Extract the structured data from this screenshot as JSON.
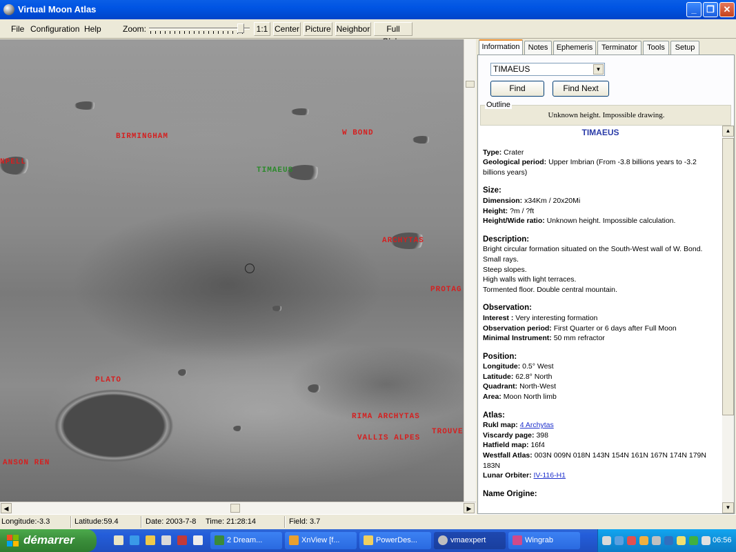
{
  "window": {
    "title": "Virtual Moon Atlas"
  },
  "menu": [
    "File",
    "Configuration",
    "Help"
  ],
  "toolbar": {
    "zoom_label": "Zoom:",
    "buttons": [
      "1:1",
      "Center",
      "Picture",
      "Neighbor",
      "Full Globe"
    ]
  },
  "map": {
    "labels": [
      {
        "text": "BIRMINGHAM",
        "color": "#d42020"
      },
      {
        "text": "W BOND",
        "color": "#d42020"
      },
      {
        "text": "NPELL",
        "color": "#d42020"
      },
      {
        "text": "TIMAEUS",
        "color": "#2a8a2a"
      },
      {
        "text": "ARCHYTAS",
        "color": "#d42020"
      },
      {
        "text": "PROTAG",
        "color": "#d42020"
      },
      {
        "text": "PLATO",
        "color": "#d42020"
      },
      {
        "text": "RIMA ARCHYTAS",
        "color": "#d42020"
      },
      {
        "text": "VALLIS ALPES",
        "color": "#d42020"
      },
      {
        "text": "TROUVE",
        "color": "#d42020"
      },
      {
        "text": "ANSON REN",
        "color": "#d42020"
      }
    ]
  },
  "tabs": [
    "Information",
    "Notes",
    "Ephemeris",
    "Terminator",
    "Tools",
    "Setup"
  ],
  "search": {
    "value": "TIMAEUS",
    "find": "Find",
    "find_next": "Find Next"
  },
  "outline": {
    "legend": "Outline",
    "message": "Unknown height. Impossible drawing."
  },
  "info": {
    "title": "TIMAEUS",
    "type_label": "Type:",
    "type": "Crater",
    "geo_label": "Geological period:",
    "geo": "Upper Imbrian (From -3.8 billions years to -3.2 billions years)",
    "size_head": "Size:",
    "dim_label": "Dimension:",
    "dim": "x34Km / 20x20Mi",
    "height_label": "Height:",
    "height": "?m / ?ft",
    "ratio_label": "Height/Wide ratio:",
    "ratio": "Unknown height. Impossible calculation.",
    "desc_head": "Description:",
    "desc_lines": [
      "Bright circular formation situated on the South-West wall of W. Bond. Small rays.",
      "Steep slopes.",
      "High walls with light terraces.",
      "Tormented floor. Double central mountain."
    ],
    "obs_head": "Observation:",
    "interest_label": "Interest :",
    "interest": "Very interesting formation",
    "period_label": "Observation period:",
    "period": "First Quarter or 6 days after Full Moon",
    "instr_label": "Minimal Instrument:",
    "instr": "50 mm refractor",
    "pos_head": "Position:",
    "lon_label": "Longitude:",
    "lon": "0.5° West",
    "lat_label": "Latitude:",
    "lat": "62.8° North",
    "quad_label": "Quadrant:",
    "quad": "North-West",
    "area_label": "Area:",
    "area": "Moon North limb",
    "atlas_head": "Atlas:",
    "rukl_label": "Rukl map:",
    "rukl": "4 Archytas",
    "viscardy_label": "Viscardy page:",
    "viscardy": "398",
    "hatfield_label": "Hatfield map:",
    "hatfield": "16f4",
    "westfall_label": "Westfall Atlas:",
    "westfall": "003N 009N 018N 143N 154N 161N 167N 174N 179N 183N",
    "orbiter_label": "Lunar Orbiter:",
    "orbiter": "IV-116-H1",
    "name_head": "Name Origine:"
  },
  "status": {
    "longitude": "Longitude:-3.3",
    "latitude": "Latitude:59.4",
    "date": "Date: 2003-7-8",
    "time": "Time: 21:28:14",
    "field": "Field: 3.7"
  },
  "taskbar": {
    "start": "démarrer",
    "tasks": [
      "2 Dream...",
      "XnView [f...",
      "PowerDes...",
      "vmaexpert",
      "Wingrab"
    ],
    "clock": "06:56"
  }
}
